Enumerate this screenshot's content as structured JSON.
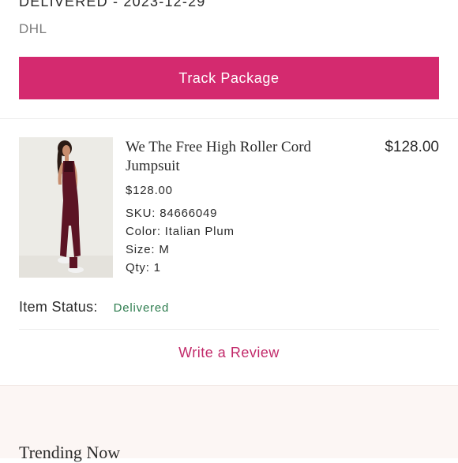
{
  "shipment": {
    "status_line": "DELIVERED - 2023-12-29",
    "carrier": "DHL",
    "track_label": "Track Package"
  },
  "item": {
    "name": "We The Free High Roller Cord Jumpsuit",
    "unit_price": "$128.00",
    "line_total": "$128.00",
    "sku_label": "SKU:",
    "sku": "84666049",
    "color_label": "Color:",
    "color": "Italian Plum",
    "size_label": "Size:",
    "size": "M",
    "qty_label": "Qty:",
    "qty": "1",
    "status_label": "Item Status:",
    "status": "Delivered",
    "review_label": "Write a Review"
  },
  "trending": {
    "title": "Trending Now"
  },
  "colors": {
    "accent": "#d42a6f",
    "status_green": "#2e7d4f"
  }
}
